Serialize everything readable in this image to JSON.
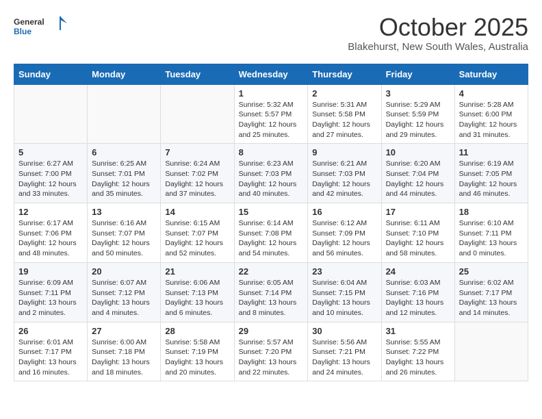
{
  "header": {
    "logo_line1": "General",
    "logo_line2": "Blue",
    "month": "October 2025",
    "location": "Blakehurst, New South Wales, Australia"
  },
  "days_of_week": [
    "Sunday",
    "Monday",
    "Tuesday",
    "Wednesday",
    "Thursday",
    "Friday",
    "Saturday"
  ],
  "weeks": [
    [
      {
        "day": "",
        "content": ""
      },
      {
        "day": "",
        "content": ""
      },
      {
        "day": "",
        "content": ""
      },
      {
        "day": "1",
        "content": "Sunrise: 5:32 AM\nSunset: 5:57 PM\nDaylight: 12 hours\nand 25 minutes."
      },
      {
        "day": "2",
        "content": "Sunrise: 5:31 AM\nSunset: 5:58 PM\nDaylight: 12 hours\nand 27 minutes."
      },
      {
        "day": "3",
        "content": "Sunrise: 5:29 AM\nSunset: 5:59 PM\nDaylight: 12 hours\nand 29 minutes."
      },
      {
        "day": "4",
        "content": "Sunrise: 5:28 AM\nSunset: 6:00 PM\nDaylight: 12 hours\nand 31 minutes."
      }
    ],
    [
      {
        "day": "5",
        "content": "Sunrise: 6:27 AM\nSunset: 7:00 PM\nDaylight: 12 hours\nand 33 minutes."
      },
      {
        "day": "6",
        "content": "Sunrise: 6:25 AM\nSunset: 7:01 PM\nDaylight: 12 hours\nand 35 minutes."
      },
      {
        "day": "7",
        "content": "Sunrise: 6:24 AM\nSunset: 7:02 PM\nDaylight: 12 hours\nand 37 minutes."
      },
      {
        "day": "8",
        "content": "Sunrise: 6:23 AM\nSunset: 7:03 PM\nDaylight: 12 hours\nand 40 minutes."
      },
      {
        "day": "9",
        "content": "Sunrise: 6:21 AM\nSunset: 7:03 PM\nDaylight: 12 hours\nand 42 minutes."
      },
      {
        "day": "10",
        "content": "Sunrise: 6:20 AM\nSunset: 7:04 PM\nDaylight: 12 hours\nand 44 minutes."
      },
      {
        "day": "11",
        "content": "Sunrise: 6:19 AM\nSunset: 7:05 PM\nDaylight: 12 hours\nand 46 minutes."
      }
    ],
    [
      {
        "day": "12",
        "content": "Sunrise: 6:17 AM\nSunset: 7:06 PM\nDaylight: 12 hours\nand 48 minutes."
      },
      {
        "day": "13",
        "content": "Sunrise: 6:16 AM\nSunset: 7:07 PM\nDaylight: 12 hours\nand 50 minutes."
      },
      {
        "day": "14",
        "content": "Sunrise: 6:15 AM\nSunset: 7:07 PM\nDaylight: 12 hours\nand 52 minutes."
      },
      {
        "day": "15",
        "content": "Sunrise: 6:14 AM\nSunset: 7:08 PM\nDaylight: 12 hours\nand 54 minutes."
      },
      {
        "day": "16",
        "content": "Sunrise: 6:12 AM\nSunset: 7:09 PM\nDaylight: 12 hours\nand 56 minutes."
      },
      {
        "day": "17",
        "content": "Sunrise: 6:11 AM\nSunset: 7:10 PM\nDaylight: 12 hours\nand 58 minutes."
      },
      {
        "day": "18",
        "content": "Sunrise: 6:10 AM\nSunset: 7:11 PM\nDaylight: 13 hours\nand 0 minutes."
      }
    ],
    [
      {
        "day": "19",
        "content": "Sunrise: 6:09 AM\nSunset: 7:11 PM\nDaylight: 13 hours\nand 2 minutes."
      },
      {
        "day": "20",
        "content": "Sunrise: 6:07 AM\nSunset: 7:12 PM\nDaylight: 13 hours\nand 4 minutes."
      },
      {
        "day": "21",
        "content": "Sunrise: 6:06 AM\nSunset: 7:13 PM\nDaylight: 13 hours\nand 6 minutes."
      },
      {
        "day": "22",
        "content": "Sunrise: 6:05 AM\nSunset: 7:14 PM\nDaylight: 13 hours\nand 8 minutes."
      },
      {
        "day": "23",
        "content": "Sunrise: 6:04 AM\nSunset: 7:15 PM\nDaylight: 13 hours\nand 10 minutes."
      },
      {
        "day": "24",
        "content": "Sunrise: 6:03 AM\nSunset: 7:16 PM\nDaylight: 13 hours\nand 12 minutes."
      },
      {
        "day": "25",
        "content": "Sunrise: 6:02 AM\nSunset: 7:17 PM\nDaylight: 13 hours\nand 14 minutes."
      }
    ],
    [
      {
        "day": "26",
        "content": "Sunrise: 6:01 AM\nSunset: 7:17 PM\nDaylight: 13 hours\nand 16 minutes."
      },
      {
        "day": "27",
        "content": "Sunrise: 6:00 AM\nSunset: 7:18 PM\nDaylight: 13 hours\nand 18 minutes."
      },
      {
        "day": "28",
        "content": "Sunrise: 5:58 AM\nSunset: 7:19 PM\nDaylight: 13 hours\nand 20 minutes."
      },
      {
        "day": "29",
        "content": "Sunrise: 5:57 AM\nSunset: 7:20 PM\nDaylight: 13 hours\nand 22 minutes."
      },
      {
        "day": "30",
        "content": "Sunrise: 5:56 AM\nSunset: 7:21 PM\nDaylight: 13 hours\nand 24 minutes."
      },
      {
        "day": "31",
        "content": "Sunrise: 5:55 AM\nSunset: 7:22 PM\nDaylight: 13 hours\nand 26 minutes."
      },
      {
        "day": "",
        "content": ""
      }
    ]
  ]
}
